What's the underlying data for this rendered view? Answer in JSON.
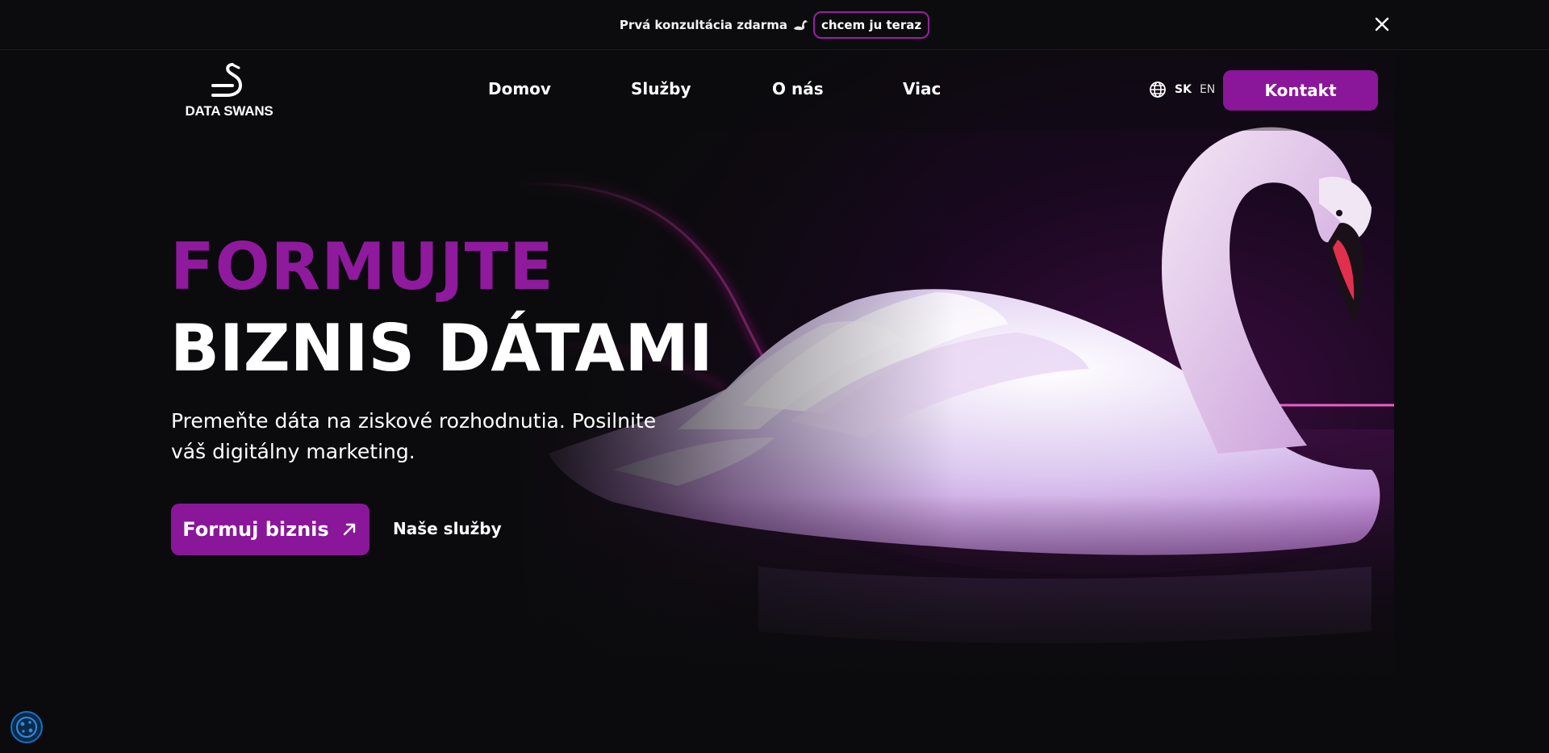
{
  "announcement": {
    "text": "Prvá konzultácia zdarma",
    "cta_label": "chcem ju teraz",
    "icons": {
      "emoji": "swan-emoji-icon",
      "close": "close-icon"
    }
  },
  "brand": {
    "name": "DATA SWANS",
    "logo_icon": "swan-logo-icon"
  },
  "nav": {
    "items": [
      {
        "label": "Domov"
      },
      {
        "label": "Služby"
      },
      {
        "label": "O nás"
      },
      {
        "label": "Viac"
      }
    ]
  },
  "language": {
    "icon": "globe-icon",
    "active": "SK",
    "other": "EN"
  },
  "header": {
    "contact_label": "Kontakt"
  },
  "hero": {
    "title_line1": "FORMUJTE",
    "title_line2": "BIZNIS DÁTAMI",
    "subtitle": "Premeňte dáta na ziskové rozhodnutia.  Posilnite váš digitálny marketing.",
    "primary_cta": "Formuj biznis",
    "secondary_cta": "Naše služby",
    "image": "swan-illustration"
  },
  "cookie": {
    "icon": "cookie-icon"
  },
  "colors": {
    "accent": "#8a1799",
    "accent_text": "#8f1a9d",
    "background": "#0b0b0d",
    "neon": "#d0199e"
  }
}
